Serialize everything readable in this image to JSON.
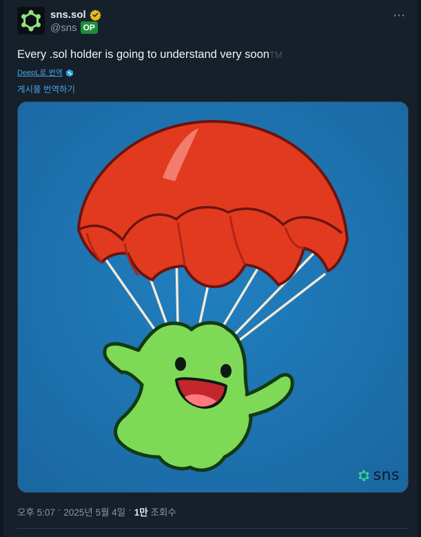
{
  "post": {
    "author": {
      "display_name": "sns.sol",
      "handle": "@sns",
      "badge": "OP",
      "verified_icon": "verified-badge-icon",
      "avatar_icon": "sns-hexagon-logo-icon"
    },
    "more_menu": "⋯",
    "text": "Every .sol holder is going to understand very soon",
    "text_suffix": "TM",
    "deepl_link": "DeepL로 번역",
    "translate_link": "게시물 번역하기",
    "media": {
      "description_icon": "parachuting-green-blob-illustration",
      "watermark": "sns"
    },
    "meta": {
      "time": "오후 5:07",
      "separator": "·",
      "date": "2025년 5월 4일",
      "views_count": "1만",
      "views_label": "조회수"
    }
  },
  "colors": {
    "background": "#15202b",
    "link": "#4aa3df",
    "op_badge": "#1d8f3a",
    "media_bg": "#1f70aa",
    "parachute": "#e8341c",
    "blob": "#7ed957"
  }
}
